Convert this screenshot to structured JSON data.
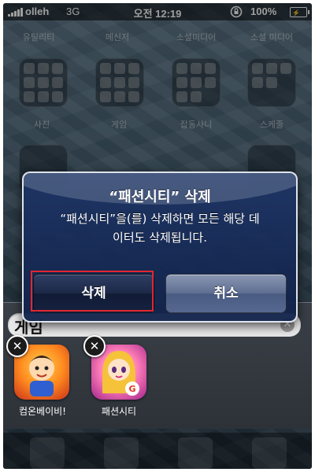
{
  "status_bar": {
    "carrier": "olleh",
    "network": "3G",
    "time": "오전 12:19",
    "battery": "100%"
  },
  "home": {
    "top_folder_labels": [
      "유틸리티",
      "메신저",
      "소셜미디어",
      "소셜 미디어"
    ],
    "folder_labels": [
      "사진",
      "게임",
      "잡동사니",
      "스케줄"
    ]
  },
  "folder": {
    "name": "게임",
    "apps": [
      {
        "label": "컴온베이비!"
      },
      {
        "label": "패션시티"
      }
    ]
  },
  "alert": {
    "title": "“패션시티” 삭제",
    "message_line1": "“패션시티”을(를) 삭제하면 모든 해당 데",
    "message_line2": "이터도 삭제됩니다.",
    "delete_label": "삭제",
    "cancel_label": "취소"
  },
  "colors": {
    "alert_bg": "#1e3566",
    "highlight": "#e3262f"
  }
}
